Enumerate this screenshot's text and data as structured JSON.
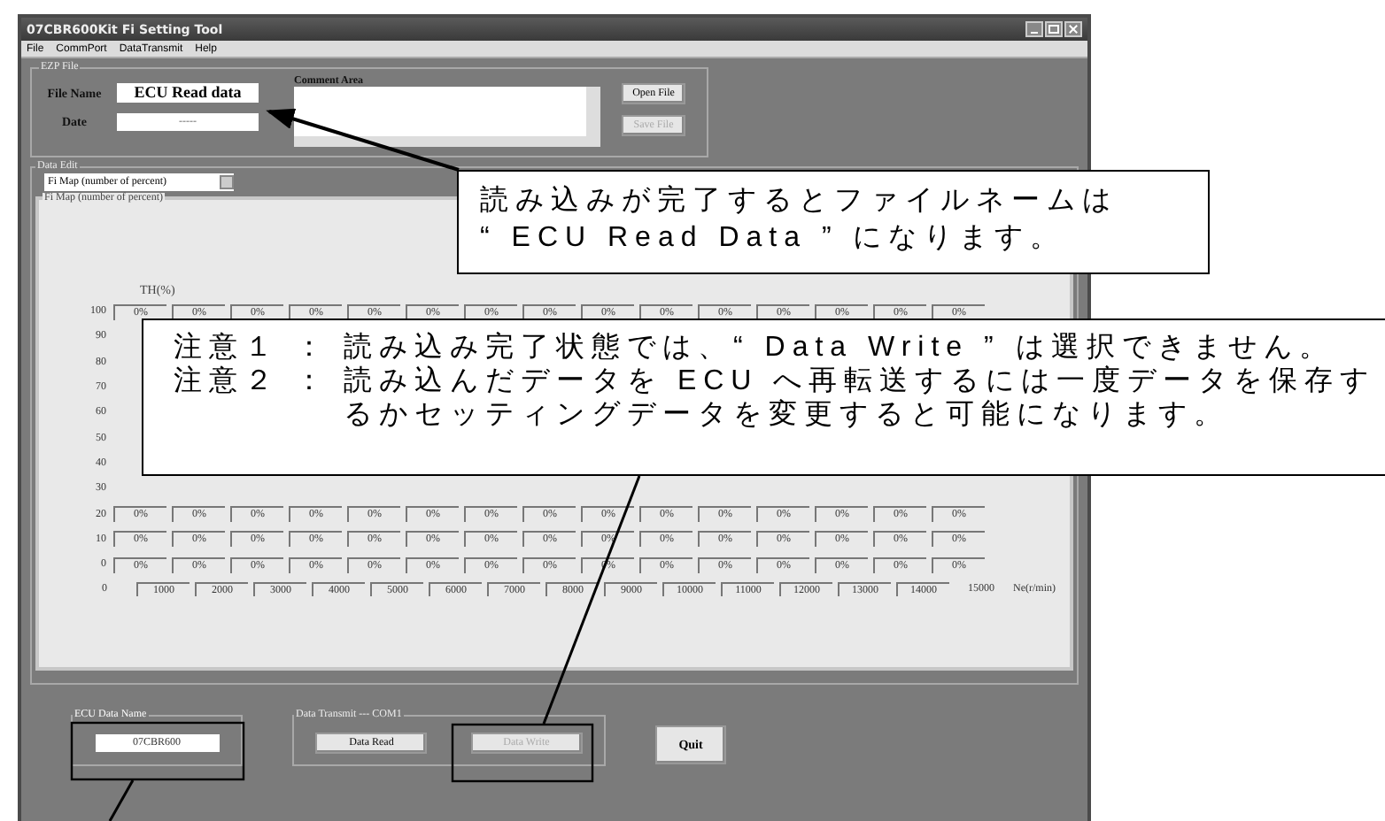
{
  "window": {
    "title": "07CBR600Kit Fi Setting Tool"
  },
  "menu": [
    "File",
    "CommPort",
    "DataTransmit",
    "Help"
  ],
  "ezp_file": {
    "label": "EZP File",
    "file_name_label": "File Name",
    "file_name": "ECU Read data",
    "date_label": "Date",
    "date": "-----",
    "comment_label": "Comment Area",
    "buttons": [
      {
        "label": "Open File",
        "disabled": false
      },
      {
        "label": "Save File",
        "disabled": true
      }
    ]
  },
  "data_edit": {
    "label": "Data Edit",
    "dropdown": "Fi Map (number of percent)"
  },
  "fi_map": {
    "label": "Fi Map (number of percent)",
    "y_axis_label": "TH(%)",
    "rows": [
      {
        "label": "100",
        "cells": [
          "0%",
          "0%",
          "0%",
          "0%",
          "0%",
          "0%",
          "0%",
          "0%",
          "0%",
          "0%",
          "0%",
          "0%",
          "0%",
          "0%",
          "0%"
        ]
      },
      {
        "label": "90"
      },
      {
        "label": "80"
      },
      {
        "label": "70"
      },
      {
        "label": "60"
      },
      {
        "label": "50"
      },
      {
        "label": "40"
      },
      {
        "label": "30"
      },
      {
        "label": "20",
        "cells": [
          "0%",
          "0%",
          "0%",
          "0%",
          "0%",
          "0%",
          "0%",
          "0%",
          "0%",
          "0%",
          "0%",
          "0%",
          "0%",
          "0%",
          "0%"
        ]
      },
      {
        "label": "10",
        "cells": [
          "0%",
          "0%",
          "0%",
          "0%",
          "0%",
          "0%",
          "0%",
          "0%",
          "0%",
          "0%",
          "0%",
          "0%",
          "0%",
          "0%",
          "0%"
        ]
      },
      {
        "label": "0",
        "cells": [
          "0%",
          "0%",
          "0%",
          "0%",
          "0%",
          "0%",
          "0%",
          "0%",
          "0%",
          "0%",
          "0%",
          "0%",
          "0%",
          "0%",
          "0%"
        ]
      }
    ],
    "x_labels": [
      "0",
      "1000",
      "2000",
      "3000",
      "4000",
      "5000",
      "6000",
      "7000",
      "8000",
      "9000",
      "10000",
      "11000",
      "12000",
      "13000",
      "14000",
      "15000"
    ],
    "x_axis_label": "Ne(r/min)"
  },
  "ecu_data_name": {
    "label": "ECU Data Name",
    "value": "07CBR600"
  },
  "data_transmit": {
    "label": "Data Transmit --- COM1",
    "buttons": [
      {
        "label": "Data Read",
        "disabled": false
      },
      {
        "label": "Data Write",
        "disabled": true
      }
    ]
  },
  "quit_button": "Quit",
  "callouts": [
    {
      "lines": [
        "読み込みが完了するとファイルネームは",
        "“ ECU Read Data ” になります。"
      ]
    },
    {
      "notes": [
        {
          "label": "注意１ ：",
          "text": "読み込み完了状態では、“ Data Write ” は選択できません。"
        },
        {
          "label": "注意２ ：",
          "text": "読み込んだデータを ECU へ再転送するには一度データを保存するかセッティングデータを変更すると可能になります。"
        }
      ]
    }
  ]
}
